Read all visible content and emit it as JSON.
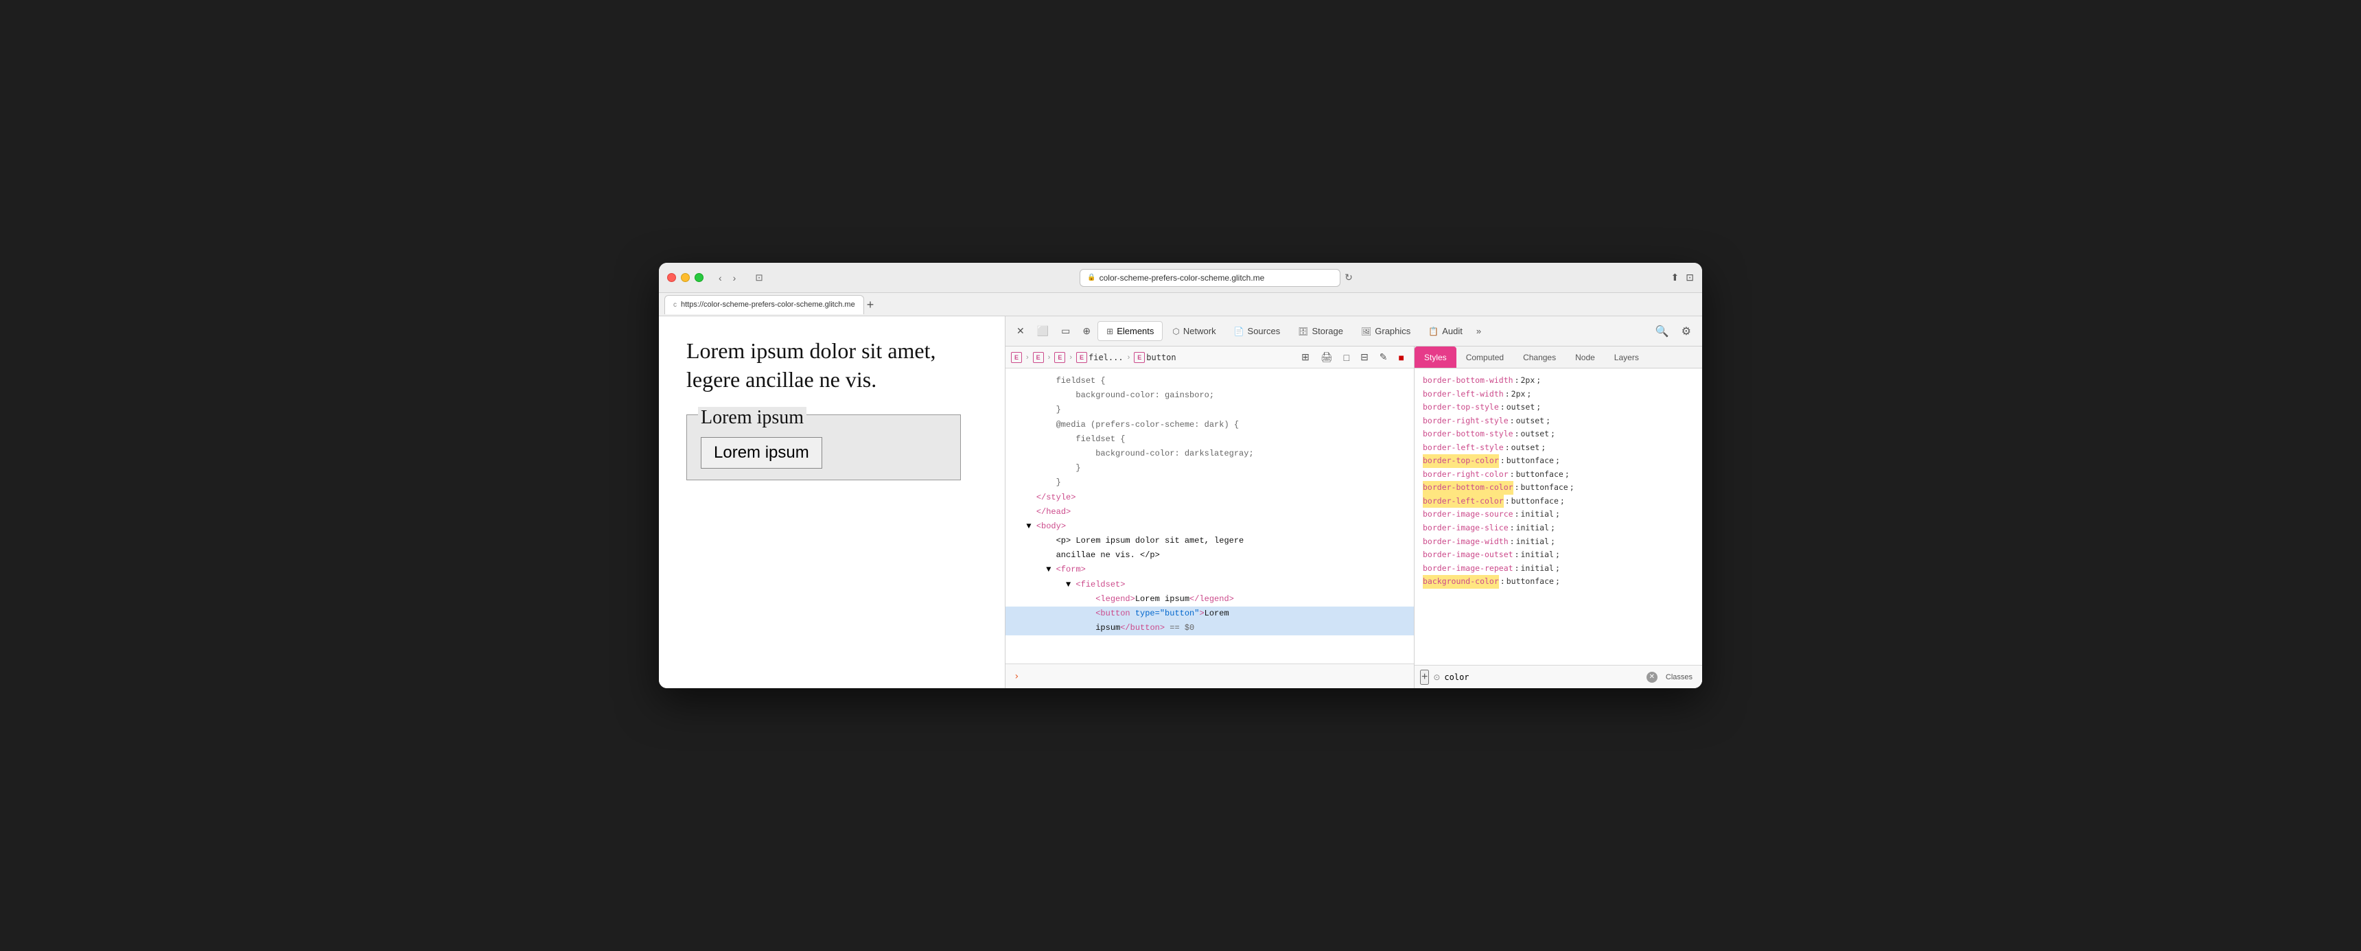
{
  "browser": {
    "title": "color-scheme-prefers-color-scheme.glitch.me",
    "url": "https://color-scheme-prefers-color-scheme.glitch.me",
    "tab_label": "https://color-scheme-prefers-color-scheme.glitch.me",
    "tab_favicon": "c"
  },
  "toolbar": {
    "close_label": "✕",
    "minimize_label": "−",
    "maximize_label": "+",
    "back_label": "‹",
    "forward_label": "›",
    "sidebar_label": "⊡"
  },
  "devtools": {
    "tabs": [
      {
        "id": "elements",
        "label": "Elements",
        "icon": "⊞",
        "active": true
      },
      {
        "id": "network",
        "label": "Network",
        "icon": "📡"
      },
      {
        "id": "sources",
        "label": "Sources",
        "icon": "📄"
      },
      {
        "id": "storage",
        "label": "Storage",
        "icon": "🗄"
      },
      {
        "id": "graphics",
        "label": "Graphics",
        "icon": "🖼"
      },
      {
        "id": "audit",
        "label": "Audit",
        "icon": "📋"
      }
    ],
    "more_label": "»",
    "search_label": "🔍",
    "settings_label": "⚙"
  },
  "breadcrumb": {
    "items": [
      {
        "box": "E",
        "label": ""
      },
      {
        "box": "E",
        "label": ""
      },
      {
        "box": "E",
        "label": ""
      },
      {
        "box": "E",
        "label": "fiel..."
      },
      {
        "box": "E",
        "label": "button"
      }
    ]
  },
  "breadcrumb_tools": [
    {
      "id": "grid",
      "icon": "⊞"
    },
    {
      "id": "print",
      "icon": "🖨"
    },
    {
      "id": "box",
      "icon": "□"
    },
    {
      "id": "grid2",
      "icon": "⊟"
    },
    {
      "id": "pen",
      "icon": "✎"
    },
    {
      "id": "color",
      "icon": "■",
      "active": true
    }
  ],
  "html_code": [
    {
      "id": 1,
      "indent": "        ",
      "content": "fieldset {",
      "classes": "hl-gray"
    },
    {
      "id": 2,
      "indent": "            ",
      "content": "background-color: gainsboro;",
      "classes": "hl-gray"
    },
    {
      "id": 3,
      "indent": "        ",
      "content": "}",
      "classes": "hl-gray"
    },
    {
      "id": 4,
      "indent": "        ",
      "content": "@media (prefers-color-scheme: dark) {",
      "classes": "hl-gray"
    },
    {
      "id": 5,
      "indent": "            ",
      "content": "fieldset {",
      "classes": "hl-gray"
    },
    {
      "id": 6,
      "indent": "                ",
      "content": "background-color: darkslategray;",
      "classes": "hl-gray"
    },
    {
      "id": 7,
      "indent": "            ",
      "content": "}",
      "classes": "hl-gray"
    },
    {
      "id": 8,
      "indent": "        ",
      "content": "}",
      "classes": "hl-gray"
    },
    {
      "id": 9,
      "indent": "    ",
      "content": "</style>",
      "classes": "hl-pink"
    },
    {
      "id": 10,
      "indent": "    ",
      "content": "</head>",
      "classes": "hl-pink"
    },
    {
      "id": 11,
      "indent": "▼ ",
      "content": "<body>",
      "classes": "hl-pink"
    },
    {
      "id": 12,
      "indent": "    ",
      "content": "<p> Lorem ipsum dolor sit amet, legere",
      "classes": "hl-dark",
      "is_text": true
    },
    {
      "id": 13,
      "indent": "    ",
      "content": "ancillae ne vis. </p>",
      "classes": "hl-dark"
    },
    {
      "id": 14,
      "indent": "    ▼ ",
      "content": "<form>",
      "classes": "hl-pink"
    },
    {
      "id": 15,
      "indent": "        ▼ ",
      "content": "<fieldset>",
      "classes": "hl-pink"
    },
    {
      "id": 16,
      "indent": "            ",
      "content": "<legend>Lorem ipsum</legend>",
      "classes": "hl-pink",
      "inner": "Lorem ipsum"
    },
    {
      "id": 17,
      "indent": "            ",
      "content": "<button type=\"button\">Lorem",
      "classes": "hl-pink",
      "selected": true
    },
    {
      "id": 18,
      "indent": "            ",
      "content": "ipsum</button> == $0",
      "classes": "hl-dark",
      "selected": true
    }
  ],
  "styles_tabs": [
    {
      "id": "styles",
      "label": "Styles",
      "active": true
    },
    {
      "id": "computed",
      "label": "Computed"
    },
    {
      "id": "changes",
      "label": "Changes"
    },
    {
      "id": "node",
      "label": "Node"
    },
    {
      "id": "layers",
      "label": "Layers"
    }
  ],
  "style_properties": [
    {
      "name": "border-bottom-width",
      "value": "2px",
      "highlighted": false
    },
    {
      "name": "border-left-width",
      "value": "2px",
      "highlighted": false
    },
    {
      "name": "border-top-style",
      "value": "outset",
      "highlighted": false
    },
    {
      "name": "border-right-style",
      "value": "outset",
      "highlighted": false
    },
    {
      "name": "border-bottom-style",
      "value": "outset",
      "highlighted": false
    },
    {
      "name": "border-left-style",
      "value": "outset",
      "highlighted": false
    },
    {
      "name": "border-top-color",
      "value": "buttonface",
      "highlighted": true
    },
    {
      "name": "border-right-color",
      "value": "buttonface",
      "highlighted": false
    },
    {
      "name": "border-bottom-color",
      "value": "buttonface",
      "highlighted": true
    },
    {
      "name": "border-left-color",
      "value": "buttonface",
      "highlighted": true
    },
    {
      "name": "border-image-source",
      "value": "initial",
      "highlighted": false
    },
    {
      "name": "border-image-slice",
      "value": "initial",
      "highlighted": false
    },
    {
      "name": "border-image-width",
      "value": "initial",
      "highlighted": false
    },
    {
      "name": "border-image-outset",
      "value": "initial",
      "highlighted": false
    },
    {
      "name": "border-image-repeat",
      "value": "initial",
      "highlighted": false
    },
    {
      "name": "background-color",
      "value": "buttonface",
      "highlighted": true,
      "highlight_type": "yellow"
    }
  ],
  "filter": {
    "placeholder": "color",
    "classes_label": "Classes"
  },
  "page_content": {
    "paragraph": "Lorem ipsum dolor sit amet,\nlegere ancillae ne vis.",
    "legend_text": "Lorem ipsum",
    "button_text": "Lorem ipsum"
  },
  "console": {
    "prompt": "›"
  }
}
